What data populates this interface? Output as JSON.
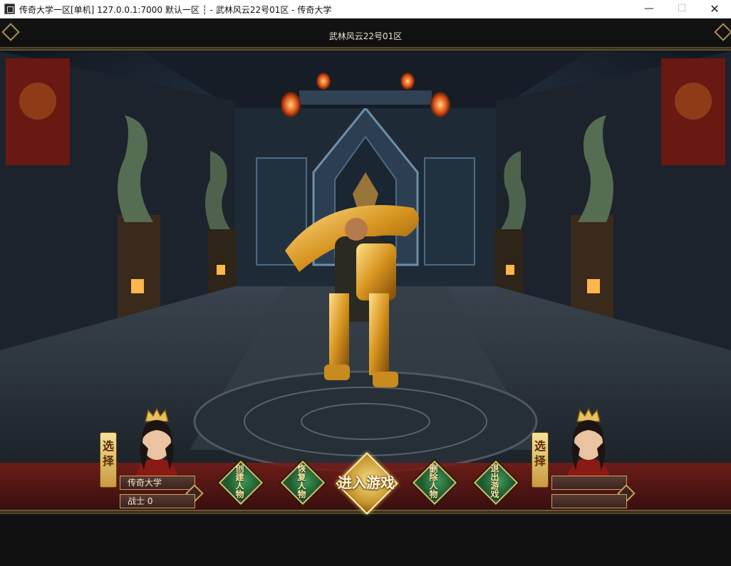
{
  "window": {
    "title": "传奇大学一区[单机] 127.0.0.1:7000  默认一区 ┆ - 武林风云22号01区 - 传奇大学",
    "minimize_glyph": "—",
    "maximize_glyph": "☐",
    "close_glyph": "✕"
  },
  "server": {
    "name": "武林风云22号01区"
  },
  "slots": {
    "left": {
      "select_label": "选择",
      "character_name": "传奇大学",
      "character_class_level": "战士 0"
    },
    "right": {
      "select_label": "选择",
      "character_name": "",
      "character_class_level": ""
    }
  },
  "actions": {
    "create": "创建人物",
    "restore": "恢复人物",
    "enter": "进入游戏",
    "delete": "删除人物",
    "exit": "退出游戏"
  },
  "colors": {
    "accent_gold": "#d8b86a",
    "button_green": "#2f7d45",
    "name_plate": "#4a2e28"
  }
}
